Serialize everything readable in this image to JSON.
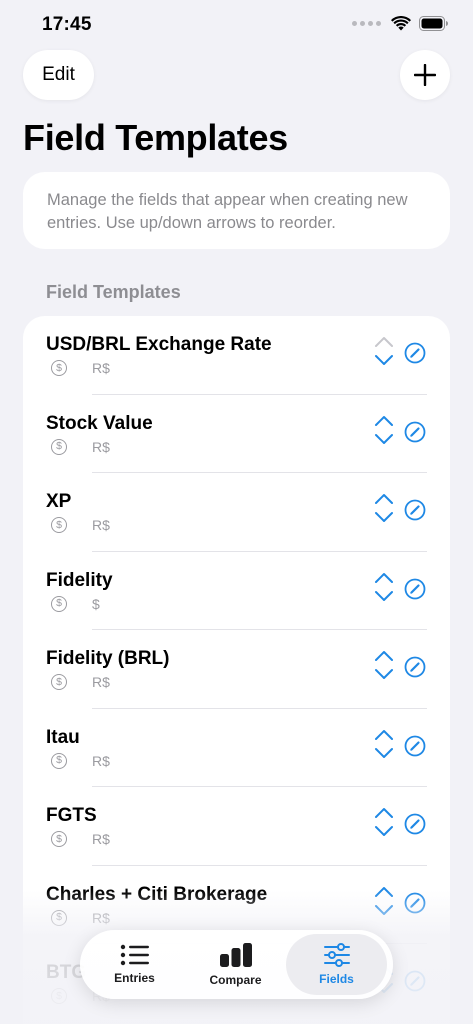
{
  "status_bar": {
    "time": "17:45"
  },
  "header": {
    "edit_label": "Edit",
    "title": "Field Templates",
    "description": "Manage the fields that appear when creating new entries. Use up/down arrows to reorder."
  },
  "section_header": "Field Templates",
  "fields": [
    {
      "name": "USD/BRL Exchange Rate",
      "unit": "R$",
      "up_enabled": false
    },
    {
      "name": "Stock Value",
      "unit": "R$",
      "up_enabled": true
    },
    {
      "name": "XP",
      "unit": "R$",
      "up_enabled": true
    },
    {
      "name": "Fidelity",
      "unit": "$",
      "up_enabled": true
    },
    {
      "name": "Fidelity (BRL)",
      "unit": "R$",
      "up_enabled": true
    },
    {
      "name": "Itau",
      "unit": "R$",
      "up_enabled": true
    },
    {
      "name": "FGTS",
      "unit": "R$",
      "up_enabled": true
    },
    {
      "name": "Charles + Citi Brokerage",
      "unit": "R$",
      "up_enabled": true
    },
    {
      "name": "BTG",
      "unit": "R$",
      "up_enabled": true
    }
  ],
  "tabs": [
    {
      "label": "Entries",
      "icon": "list-icon",
      "active": false
    },
    {
      "label": "Compare",
      "icon": "bar-chart-icon",
      "active": false
    },
    {
      "label": "Fields",
      "icon": "sliders-icon",
      "active": true
    }
  ],
  "colors": {
    "accent": "#1e88e5",
    "background": "#f2f2f7",
    "secondary_text": "#8e8e93"
  }
}
